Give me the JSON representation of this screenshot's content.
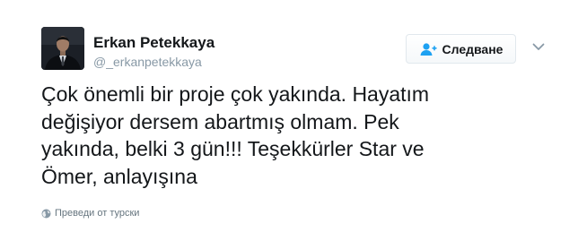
{
  "user": {
    "display_name": "Erkan Petekkaya",
    "screen_name": "@_erkanpetekkaya",
    "avatar_icon": "person-in-suit-avatar"
  },
  "follow": {
    "label": "Следване",
    "icon": "add-user-icon"
  },
  "more_menu": {
    "icon": "chevron-down-icon"
  },
  "tweet": {
    "text": "Çok önemli bir proje çok yakında. Hayatım\ndeğişiyor dersem abartmış olmam. Pek\nyakında, belki 3 gün!!! Teşekkürler Star ve\nÖmer, anlayışına"
  },
  "translate": {
    "label": "Преведи от турски",
    "icon": "globe-icon"
  },
  "colors": {
    "text": "#14171a",
    "secondary": "#8899a6",
    "border": "#e1e8ed",
    "accent": "#1da1f2"
  }
}
